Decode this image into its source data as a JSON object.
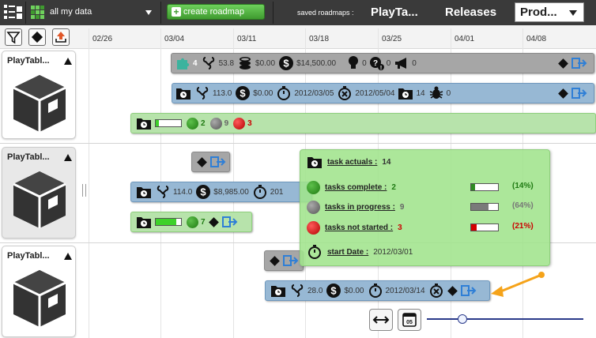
{
  "topbar": {
    "dataset_label": "all my data",
    "create_button": "create roadmap",
    "saved_label": "saved roadmaps :",
    "saved_tabs": [
      "PlayTa...",
      "Releases"
    ],
    "selected_roadmap": "Prod..."
  },
  "timeline": {
    "dates": [
      "02/26",
      "03/04",
      "03/11",
      "03/18",
      "03/25",
      "04/01",
      "04/08"
    ]
  },
  "panels": [
    {
      "title": "PlayTabl..."
    },
    {
      "title": "PlayTabl..."
    },
    {
      "title": "PlayTabl..."
    }
  ],
  "bars": {
    "bar1": {
      "count": "4",
      "value": "53.8",
      "cost": "$0.00",
      "budget": "$14,500.00",
      "ideas": "0",
      "questions": "0",
      "announcements": "0"
    },
    "bar2": {
      "effort": "113.0",
      "cost": "$0.00",
      "start_date": "2012/03/05",
      "end_date": "2012/05/04",
      "tasks": "14",
      "bugs": "0"
    },
    "bar3": {
      "complete": "2",
      "in_progress": "9",
      "not_started": "3",
      "progress": 0.14
    },
    "bar5": {
      "effort": "114.0",
      "cost": "$8,985.00",
      "start_partial": "201"
    },
    "bar6": {
      "complete": "7",
      "progress": 0.8
    },
    "bar8": {
      "effort": "28.0",
      "cost": "$0.00",
      "start_date": "2012/03/14"
    }
  },
  "tooltip": {
    "actuals_label": "task actuals :",
    "actuals_value": "14",
    "complete_label": "tasks complete :",
    "complete_value": "2",
    "complete_pct": "(14%)",
    "complete_fraction": 0.14,
    "progress_label": "tasks in progress :",
    "progress_value": "9",
    "progress_pct": "(64%)",
    "progress_fraction": 0.64,
    "notstarted_label": "tasks not started :",
    "notstarted_value": "3",
    "notstarted_pct": "(21%)",
    "notstarted_fraction": 0.21,
    "start_label": "start Date :",
    "start_value": "2012/03/01"
  },
  "colors": {
    "accent_green": "#3f9a2f",
    "bar_blue": "#97b8d4",
    "bar_grey": "#a6a6a6",
    "bar_green": "#b7e3ab",
    "callout_orange": "#f5a31a"
  }
}
